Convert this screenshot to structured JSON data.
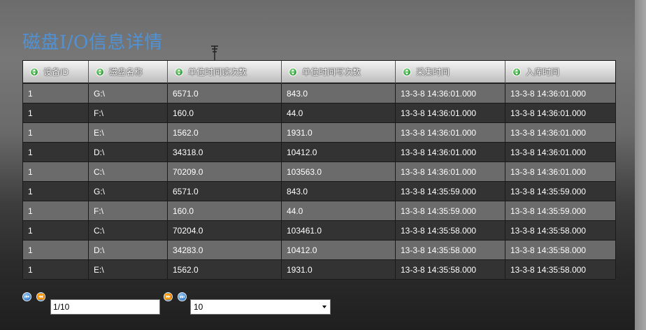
{
  "page": {
    "title": "磁盘I/O信息详情"
  },
  "table": {
    "columns": [
      "设备ID",
      "磁盘名称",
      "单位时间读次数",
      "单位时间写次数",
      "采集时间",
      "入库时间"
    ],
    "rows": [
      [
        "1",
        "G:\\",
        "6571.0",
        "843.0",
        "13-3-8 14:36:01.000",
        "13-3-8 14:36:01.000"
      ],
      [
        "1",
        "F:\\",
        "160.0",
        "44.0",
        "13-3-8 14:36:01.000",
        "13-3-8 14:36:01.000"
      ],
      [
        "1",
        "E:\\",
        "1562.0",
        "1931.0",
        "13-3-8 14:36:01.000",
        "13-3-8 14:36:01.000"
      ],
      [
        "1",
        "D:\\",
        "34318.0",
        "10412.0",
        "13-3-8 14:36:01.000",
        "13-3-8 14:36:01.000"
      ],
      [
        "1",
        "C:\\",
        "70209.0",
        "103563.0",
        "13-3-8 14:36:01.000",
        "13-3-8 14:36:01.000"
      ],
      [
        "1",
        "G:\\",
        "6571.0",
        "843.0",
        "13-3-8 14:35:59.000",
        "13-3-8 14:35:59.000"
      ],
      [
        "1",
        "F:\\",
        "160.0",
        "44.0",
        "13-3-8 14:35:59.000",
        "13-3-8 14:35:59.000"
      ],
      [
        "1",
        "C:\\",
        "70204.0",
        "103461.0",
        "13-3-8 14:35:58.000",
        "13-3-8 14:35:58.000"
      ],
      [
        "1",
        "D:\\",
        "34283.0",
        "10412.0",
        "13-3-8 14:35:58.000",
        "13-3-8 14:35:58.000"
      ],
      [
        "1",
        "E:\\",
        "1562.0",
        "1931.0",
        "13-3-8 14:35:58.000",
        "13-3-8 14:35:58.000"
      ]
    ]
  },
  "pager": {
    "page_value": "1/10",
    "page_size": "10",
    "icons": {
      "first": "first-page-icon",
      "prev": "previous-page-icon",
      "next": "next-page-icon",
      "last": "last-page-icon"
    }
  },
  "colors": {
    "title": "#4f92d6",
    "row_odd": "#6b6b6b",
    "row_even": "#333333",
    "sort_icon": "#2e9a36",
    "pager_icon": "#3a7fc9"
  }
}
